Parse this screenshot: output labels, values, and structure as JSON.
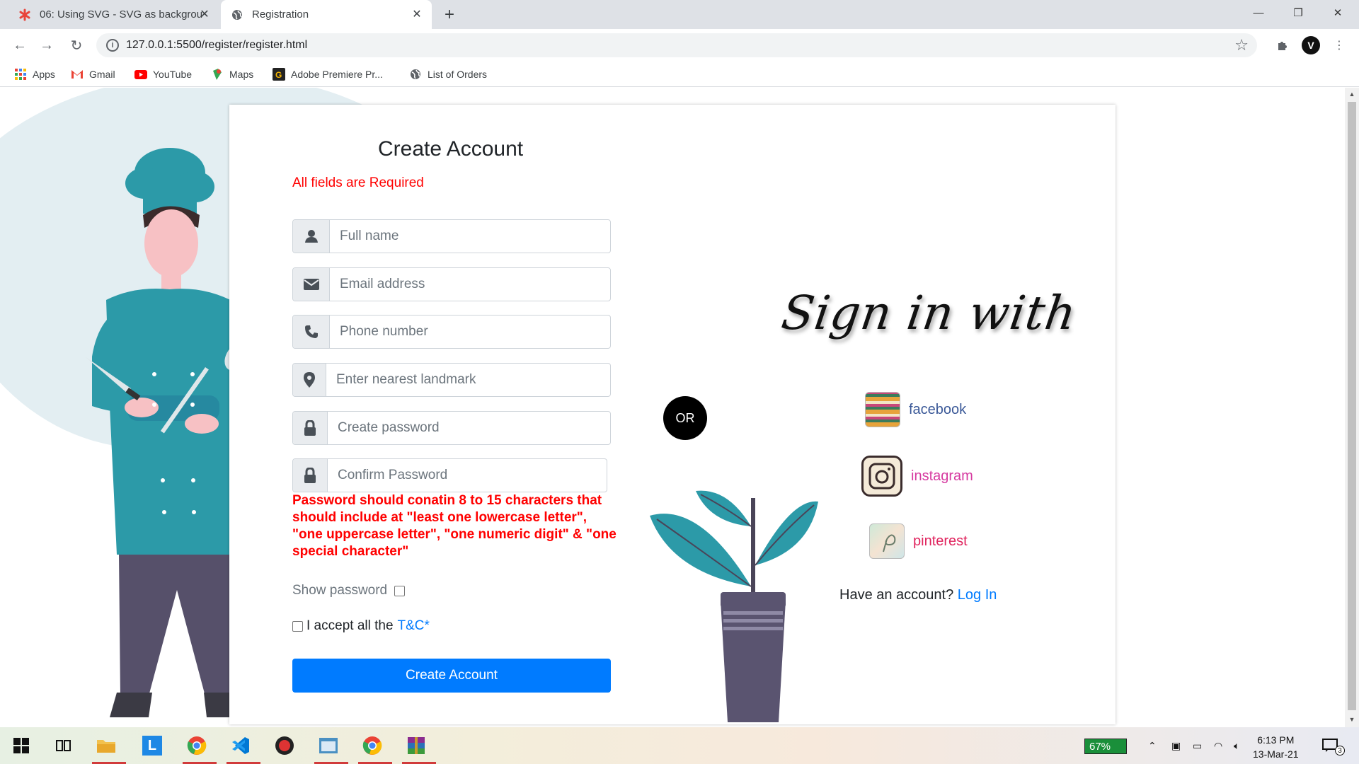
{
  "browser": {
    "tabs": [
      {
        "title": "06: Using SVG - SVG as backgrou",
        "active": false
      },
      {
        "title": "Registration",
        "active": true
      }
    ],
    "url": "127.0.0.1:5500/register/register.html",
    "bookmarks": [
      "Apps",
      "Gmail",
      "YouTube",
      "Maps",
      "Adobe Premiere Pr...",
      "List of Orders"
    ],
    "profile_initial": "V"
  },
  "form": {
    "title": "Create Account",
    "required_note": "All fields are Required",
    "fields": {
      "fullname": "Full name",
      "email": "Email address",
      "phone": "Phone number",
      "landmark": "Enter nearest landmark",
      "password": "Create password",
      "confirm": "Confirm Password"
    },
    "password_hint": "Password should conatin 8 to 15 characters that should include at \"least one lowercase letter\", \"one uppercase letter\", \"one numeric digit\" & \"one special character\"",
    "show_password": "Show password",
    "accept_text": "I accept all the",
    "tc_link": "T&C*",
    "submit": "Create Account"
  },
  "or_label": "OR",
  "signin": {
    "heading": "Sign in with",
    "facebook": "facebook",
    "instagram": "instagram",
    "pinterest": "pinterest",
    "have_account": "Have an account?",
    "login_link": "Log In"
  },
  "colors": {
    "facebook": "#3b5998",
    "instagram": "#d63aa0",
    "pinterest": "#e0245e",
    "primary": "#007bff",
    "error": "#ff0000"
  },
  "taskbar": {
    "battery": "67%",
    "time": "6:13 PM",
    "date": "13-Mar-21",
    "notifications": "3"
  }
}
